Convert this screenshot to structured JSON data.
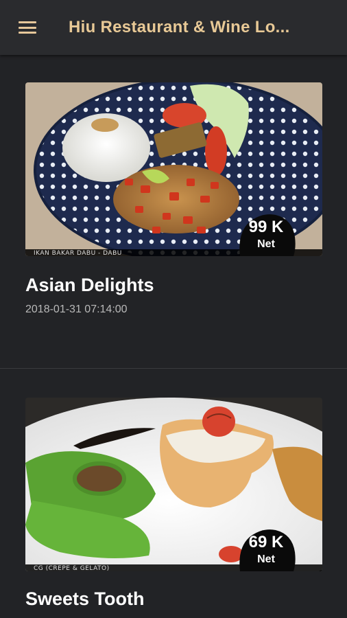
{
  "appbar": {
    "title": "Hiu Restaurant & Wine Lo..."
  },
  "cards": [
    {
      "title": "Asian Delights",
      "date": "2018-01-31 07:14:00",
      "price": "99 K",
      "price_note": "Net",
      "caption": "IKAN BAKAR DABU - DABU"
    },
    {
      "title": "Sweets Tooth",
      "price": "69 K",
      "price_note": "Net",
      "caption": "CG (CREPE & GELATO)"
    }
  ],
  "icons": {
    "menu": "hamburger-menu-icon"
  },
  "colors": {
    "accent": "#e8c996",
    "background": "#222326",
    "appbar": "#2a2b2e"
  }
}
